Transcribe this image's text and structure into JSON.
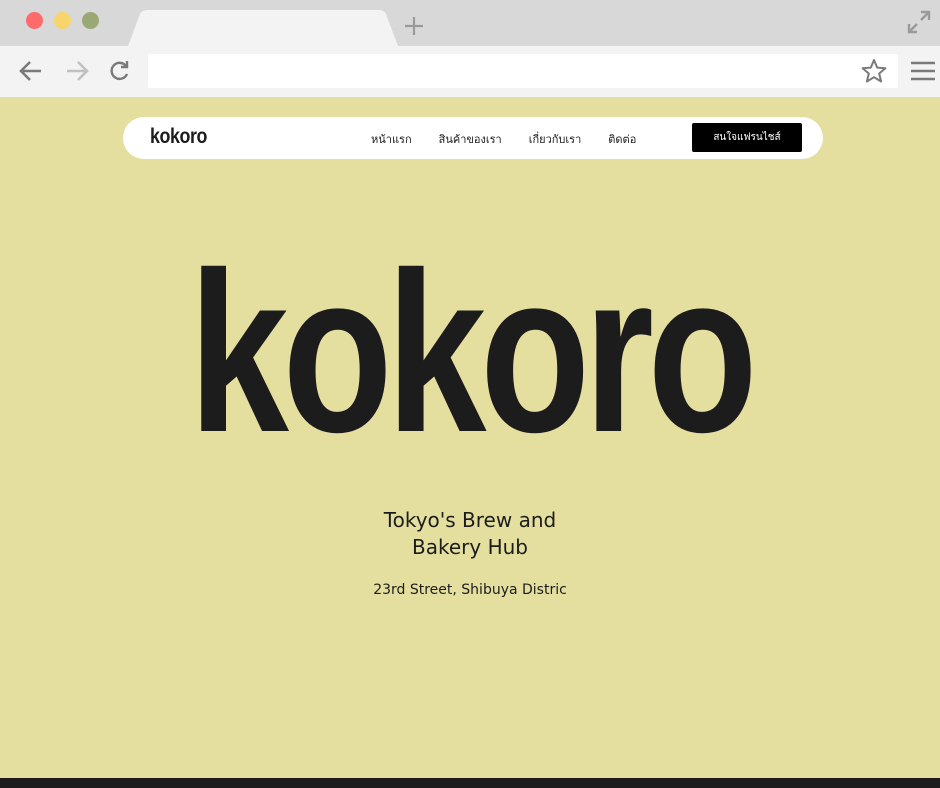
{
  "browser": {
    "icons": {
      "close": "close-dot-icon",
      "minimize": "minimize-dot-icon",
      "maximize": "maximize-dot-icon",
      "new_tab": "plus-icon",
      "expand": "expand-icon",
      "back": "arrow-left-icon",
      "forward": "arrow-right-icon",
      "reload": "reload-icon",
      "bookmark": "star-icon",
      "menu": "hamburger-icon"
    },
    "url": "",
    "colors": {
      "close": "#ff6b6b",
      "minimize": "#f7d56b",
      "maximize": "#9aa874"
    }
  },
  "site": {
    "brand": "kokoro",
    "nav": [
      "หน้าแรก",
      "สินค้าของเรา",
      "เกี่ยวกับเรา",
      "ติดต่อ"
    ],
    "cta_label": "สนใจแฟรนไชส์",
    "hero_title": "kokoro",
    "tagline_line1": "Tokyo's Brew and",
    "tagline_line2": "Bakery Hub",
    "address": "23rd Street, Shibuya Distric",
    "colors": {
      "background": "#e5df9f",
      "text": "#1c1c1c",
      "cta_bg": "#000000",
      "cta_text": "#ffffff"
    }
  }
}
